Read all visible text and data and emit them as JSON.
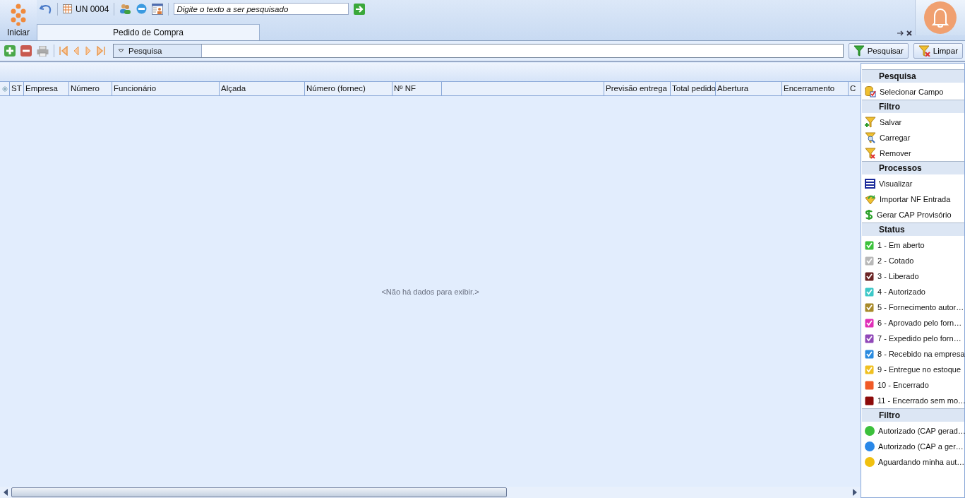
{
  "top_bar": {
    "start_label": "Iniciar",
    "unit": "UN 0004",
    "search": {
      "placeholder": "Digite o texto a ser pesquisado"
    }
  },
  "tabs": [
    {
      "label": "Pedido de Compra",
      "selected": true
    }
  ],
  "toolbar": {
    "search_panel": "Pesquisa",
    "buttons": [
      "Pesquisar",
      "Limpar"
    ]
  },
  "table": {
    "columns": [
      "ST",
      "Empresa",
      "Número",
      "Funcionário",
      "Alçada",
      "Número (fornec)",
      "Nº NF",
      "",
      "Previsão entrega",
      "Total pedido",
      "Abertura",
      "Encerramento",
      "C"
    ],
    "empty_text": "<Não há dados para exibir.>"
  },
  "side_panel": {
    "sections": [
      {
        "title": "Pesquisa",
        "items": [
          {
            "label": "Selecionar Campo",
            "kind": "field-select"
          }
        ]
      },
      {
        "title": "Filtro",
        "items": [
          {
            "label": "Salvar",
            "kind": "filter-add"
          },
          {
            "label": "Carregar",
            "kind": "filter-search"
          },
          {
            "label": "Remover",
            "kind": "filter-remove"
          }
        ]
      },
      {
        "title": "Processos",
        "items": [
          {
            "label": "Visualizar",
            "kind": "view"
          },
          {
            "label": "Importar NF Entrada",
            "kind": "import"
          },
          {
            "label": "Gerar CAP Provisório",
            "kind": "dollar"
          }
        ]
      },
      {
        "title": "Status",
        "items": [
          {
            "label": "1 - Em aberto",
            "kind": "tick",
            "color": "#3cc23c"
          },
          {
            "label": "2 - Cotado",
            "kind": "tick",
            "color": "#b8b8b8"
          },
          {
            "label": "3 - Liberado",
            "kind": "tick",
            "color": "#6b2424"
          },
          {
            "label": "4 - Autorizado",
            "kind": "tick",
            "color": "#3cc8c8"
          },
          {
            "label": "5 - Fornecimento autor…",
            "kind": "tick",
            "color": "#a88a2a"
          },
          {
            "label": "6 - Aprovado pelo forn…",
            "kind": "tick",
            "color": "#e030b8"
          },
          {
            "label": "7 - Expedido pelo forn…",
            "kind": "tick",
            "color": "#9048b8"
          },
          {
            "label": "8 - Recebido na empresa",
            "kind": "tick",
            "color": "#2c8ce0"
          },
          {
            "label": "9 - Entregue no estoque",
            "kind": "tick",
            "color": "#f0c020"
          },
          {
            "label": "10 - Encerrado",
            "kind": "square",
            "color": "#f05a28"
          },
          {
            "label": "11 - Encerrado sem mo…",
            "kind": "square",
            "color": "#8c0a0a"
          }
        ]
      },
      {
        "title": "Filtro",
        "items": [
          {
            "label": "Autorizado (CAP gerad…",
            "kind": "dot",
            "color": "#3cc03c"
          },
          {
            "label": "Autorizado (CAP a ger…",
            "kind": "dot",
            "color": "#2a88e8"
          },
          {
            "label": "Aguardando minha aut…",
            "kind": "dot",
            "color": "#f0c010"
          }
        ]
      }
    ]
  }
}
